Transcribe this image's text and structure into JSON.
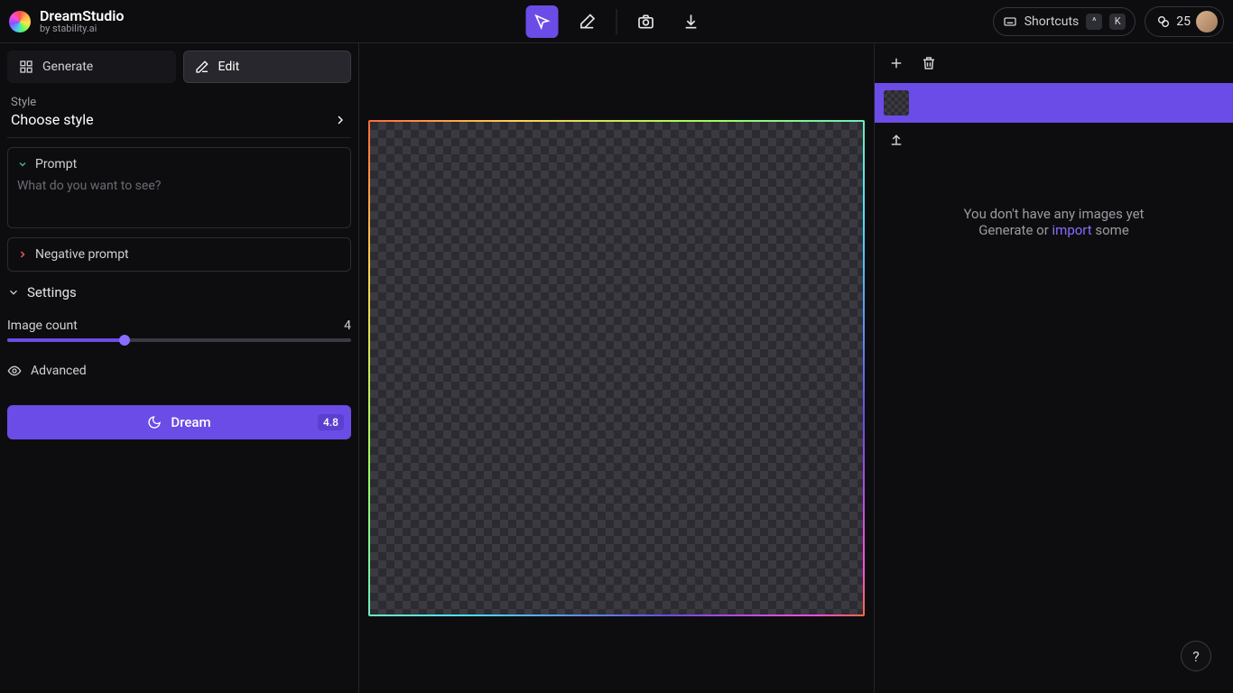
{
  "brand": {
    "title": "DreamStudio",
    "subtitle": "by stability.ai"
  },
  "topbar": {
    "shortcuts_label": "Shortcuts",
    "shortcut_keys": [
      "^",
      "K"
    ],
    "credits": "25"
  },
  "modes": {
    "generate": "Generate",
    "edit": "Edit",
    "active": "edit"
  },
  "style": {
    "label": "Style",
    "value": "Choose style"
  },
  "prompt": {
    "header": "Prompt",
    "placeholder": "What do you want to see?",
    "value": ""
  },
  "neg_prompt": {
    "header": "Negative prompt"
  },
  "settings": {
    "header": "Settings",
    "image_count_label": "Image count",
    "image_count_value": "4",
    "advanced_label": "Advanced"
  },
  "dream": {
    "label": "Dream",
    "cost": "4.8"
  },
  "gallery": {
    "empty_line1": "You don't have any images yet",
    "empty_prefix": "Generate or ",
    "import_label": "import",
    "empty_suffix": " some"
  },
  "help": {
    "symbol": "?"
  }
}
